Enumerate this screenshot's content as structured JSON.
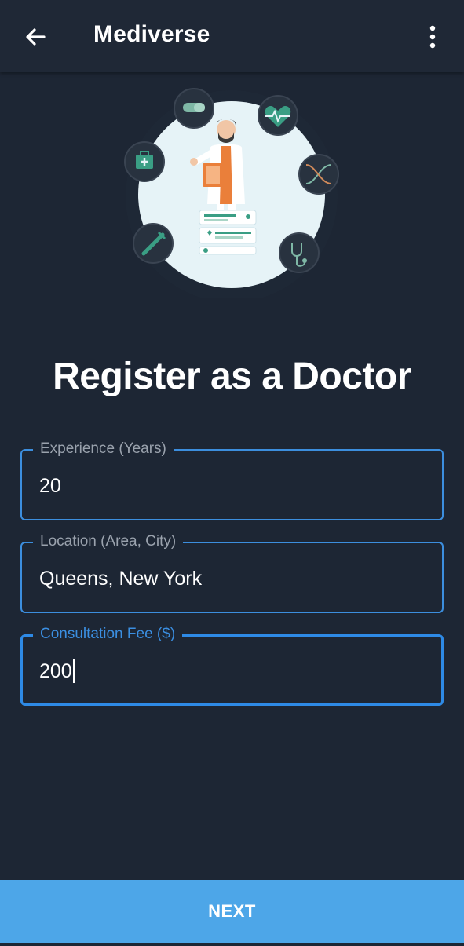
{
  "app_bar": {
    "title": "Mediverse",
    "back_icon": "arrow-left-icon",
    "menu_icon": "more-vertical-icon"
  },
  "hero": {
    "illustration": "doctor-illustration",
    "icons": [
      "pill-icon",
      "heart-pulse-icon",
      "medical-kit-icon",
      "dna-icon",
      "syringe-icon",
      "stethoscope-icon"
    ]
  },
  "heading": "Register as a Doctor",
  "form": {
    "experience": {
      "label": "Experience (Years)",
      "value": "20"
    },
    "location": {
      "label": "Location (Area, City)",
      "value": "Queens, New York"
    },
    "fee": {
      "label": "Consultation Fee ($)",
      "value": "200"
    }
  },
  "actions": {
    "next_label": "NEXT"
  },
  "colors": {
    "background": "#1d2634",
    "accent": "#3b8fe2",
    "button": "#4da6e8",
    "illustration_circle": "#e6f3f7",
    "teal": "#3a9e84",
    "orange": "#ea7f3a"
  }
}
